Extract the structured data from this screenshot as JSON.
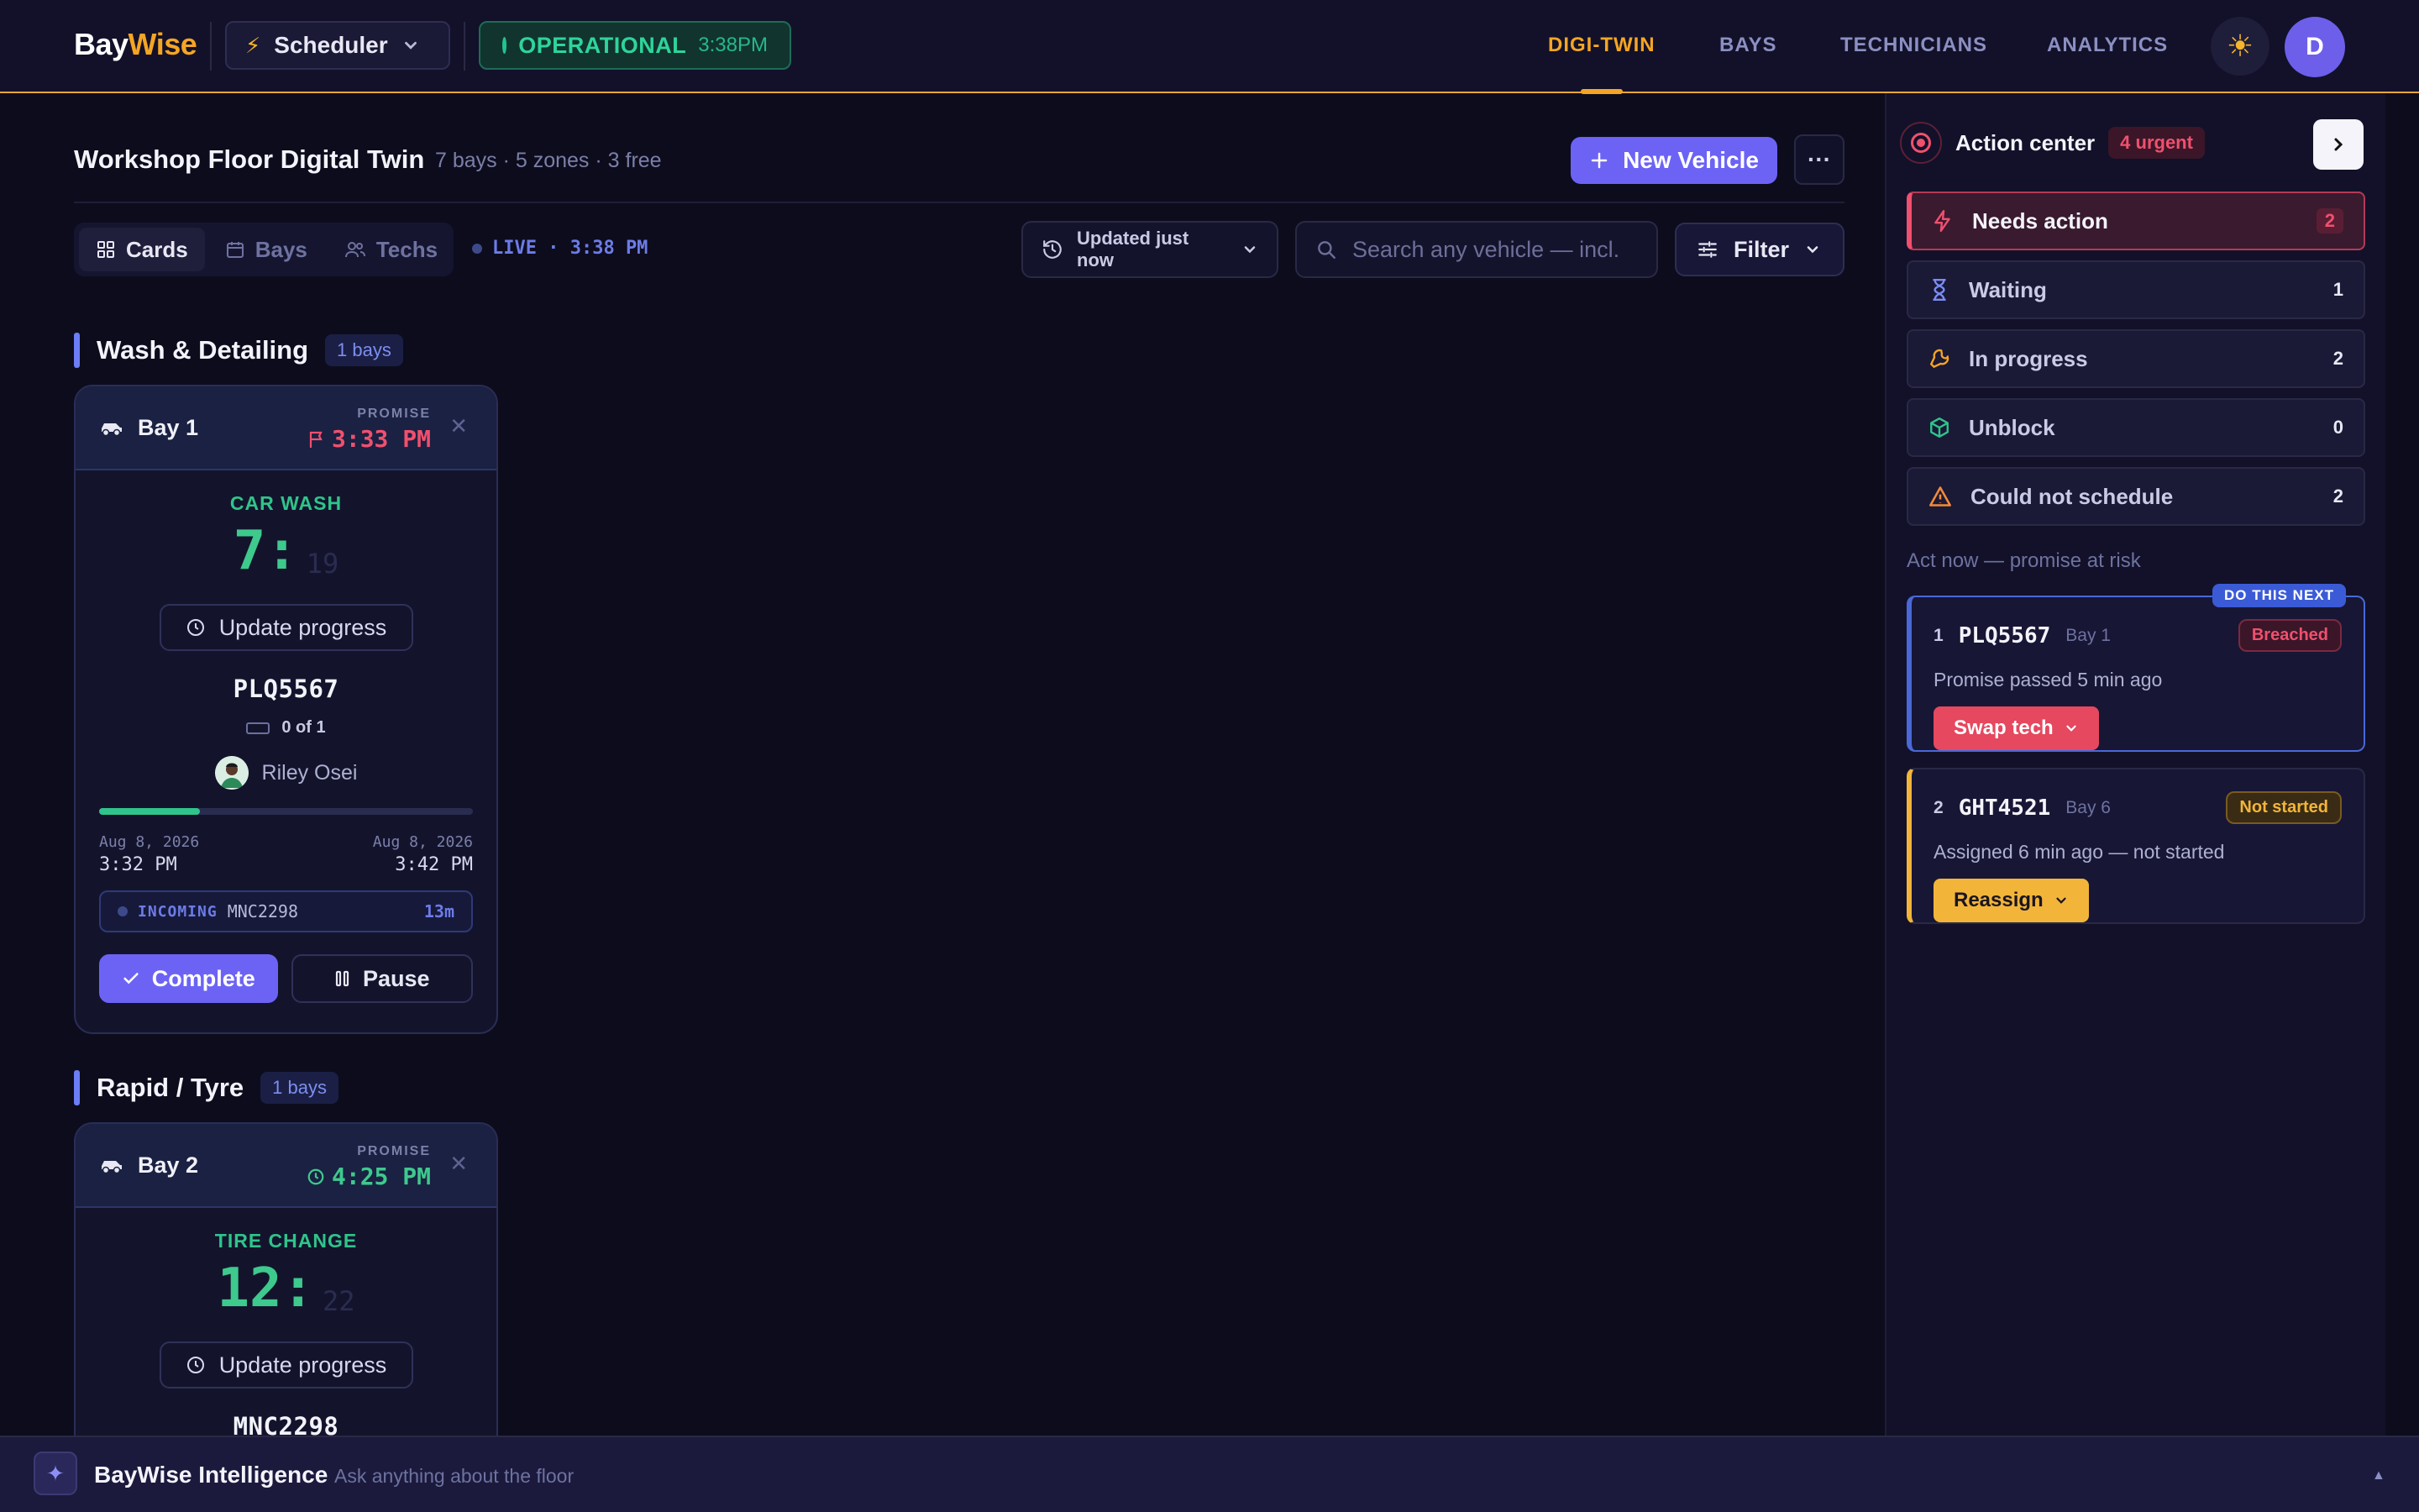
{
  "brand": {
    "part1": "Bay",
    "part2": "Wise"
  },
  "header": {
    "scheduler_label": "Scheduler",
    "status_label": "OPERATIONAL",
    "status_time": "3:38PM",
    "nav": [
      {
        "label": "DIGI-TWIN",
        "active": true
      },
      {
        "label": "BAYS"
      },
      {
        "label": "TECHNICIANS"
      },
      {
        "label": "ANALYTICS"
      }
    ],
    "user_initial": "D"
  },
  "main": {
    "title": "Workshop Floor Digital Twin",
    "subtitle": "7 bays · 5 zones · 3 free",
    "new_vehicle_label": "New Vehicle",
    "views": [
      {
        "label": "Cards",
        "active": true
      },
      {
        "label": "Bays"
      },
      {
        "label": "Techs"
      }
    ],
    "live_label": "LIVE · 3:38 PM",
    "updated_label": "Updated just now",
    "search_placeholder": "Search any vehicle — incl. queued",
    "filter_label": "Filter"
  },
  "zones": [
    {
      "name": "Wash & Detailing",
      "badge": "1 bays",
      "bay": {
        "name": "Bay 1",
        "promise_label": "PROMISE",
        "promise_time": "3:33 PM",
        "promise_color": "#f0506e",
        "job_type": "CAR WASH",
        "timer_main": "7:",
        "timer_sub": "19",
        "update_label": "Update progress",
        "plate": "PLQ5567",
        "count": "0 of 1",
        "tech": "Riley Osei",
        "progress": 0.27,
        "start_date": "Aug 8, 2026",
        "start_time": "3:32 PM",
        "end_date": "Aug 8, 2026",
        "end_time": "3:42 PM",
        "incoming_label": "INCOMING",
        "incoming_plate": "MNC2298",
        "incoming_eta": "13m",
        "complete_label": "Complete",
        "pause_label": "Pause"
      }
    },
    {
      "name": "Rapid / Tyre",
      "badge": "1 bays",
      "bay": {
        "name": "Bay 2",
        "promise_label": "PROMISE",
        "promise_time": "4:25 PM",
        "promise_color": "#3ec98d",
        "job_type": "TIRE CHANGE",
        "timer_main": "12:",
        "timer_sub": "22",
        "update_label": "Update progress",
        "plate": "MNC2298"
      }
    }
  ],
  "action_center": {
    "title": "Action center",
    "urgent": "4 urgent",
    "categories": [
      {
        "label": "Needs action",
        "count": "2",
        "icon": "bolt-icon"
      },
      {
        "label": "Waiting",
        "count": "1",
        "icon": "hourglass-icon"
      },
      {
        "label": "In progress",
        "count": "2",
        "icon": "wrench-icon"
      },
      {
        "label": "Unblock",
        "count": "0",
        "icon": "cube-icon"
      },
      {
        "label": "Could not schedule",
        "count": "2",
        "icon": "warning-icon"
      }
    ],
    "act_now_label": "Act now — promise at risk",
    "do_next_label": "DO THIS NEXT",
    "items": [
      {
        "index": "1",
        "plate": "PLQ5567",
        "bay": "Bay 1",
        "status": "Breached",
        "message": "Promise passed 5 min ago",
        "action": "Swap tech"
      },
      {
        "index": "2",
        "plate": "GHT4521",
        "bay": "Bay 6",
        "status": "Not started",
        "message": "Assigned 6 min ago — not started",
        "action": "Reassign"
      }
    ]
  },
  "assistant": {
    "title": "BayWise Intelligence",
    "placeholder": "Ask anything about the floor"
  }
}
